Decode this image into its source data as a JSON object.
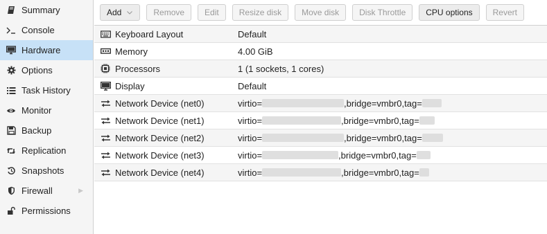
{
  "sidebar": {
    "items": [
      {
        "label": "Summary",
        "icon": "book-icon"
      },
      {
        "label": "Console",
        "icon": "terminal-icon"
      },
      {
        "label": "Hardware",
        "icon": "desktop-icon",
        "active": true
      },
      {
        "label": "Options",
        "icon": "gear-icon"
      },
      {
        "label": "Task History",
        "icon": "list-icon"
      },
      {
        "label": "Monitor",
        "icon": "eye-icon"
      },
      {
        "label": "Backup",
        "icon": "floppy-icon"
      },
      {
        "label": "Replication",
        "icon": "retweet-icon"
      },
      {
        "label": "Snapshots",
        "icon": "history-icon"
      },
      {
        "label": "Firewall",
        "icon": "shield-icon",
        "has_submenu": true
      },
      {
        "label": "Permissions",
        "icon": "unlock-icon"
      }
    ]
  },
  "toolbar": {
    "add_label": "Add",
    "remove_label": "Remove",
    "edit_label": "Edit",
    "resize_label": "Resize disk",
    "move_label": "Move disk",
    "throttle_label": "Disk Throttle",
    "cpu_label": "CPU options",
    "revert_label": "Revert"
  },
  "hardware": {
    "rows": [
      {
        "key": "Keyboard Layout",
        "value": "Default",
        "icon": "keyboard-icon"
      },
      {
        "key": "Memory",
        "value": "4.00 GiB",
        "icon": "memory-icon"
      },
      {
        "key": "Processors",
        "value": "1 (1 sockets, 1 cores)",
        "icon": "cpu-icon"
      },
      {
        "key": "Display",
        "value": "Default",
        "icon": "monitor-icon"
      },
      {
        "key": "Network Device (net0)",
        "prefix": "virtio=",
        "middle": ",bridge=vmbr0,tag=",
        "icon": "exchange-icon"
      },
      {
        "key": "Network Device (net1)",
        "prefix": "virtio=",
        "middle": ",bridge=vmbr0,tag=",
        "icon": "exchange-icon"
      },
      {
        "key": "Network Device (net2)",
        "prefix": "virtio=",
        "middle": ",bridge=vmbr0,tag=",
        "icon": "exchange-icon"
      },
      {
        "key": "Network Device (net3)",
        "prefix": "virtio=",
        "middle": ",bridge=vmbr0,tag=",
        "icon": "exchange-icon"
      },
      {
        "key": "Network Device (net4)",
        "prefix": "virtio=",
        "middle": ",bridge=vmbr0,tag=",
        "icon": "exchange-icon"
      }
    ]
  },
  "colors": {
    "sidebar_bg": "#f5f5f5",
    "active_bg": "#c7e1f7",
    "alt_row_bg": "#f5f5f5",
    "disabled_text": "#9a9a9a"
  }
}
